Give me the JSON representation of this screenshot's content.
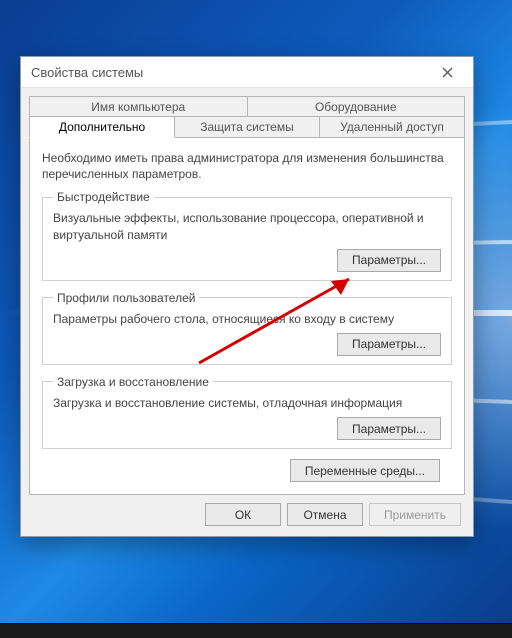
{
  "window": {
    "title": "Свойства системы"
  },
  "tabs": {
    "row1": [
      "Имя компьютера",
      "Оборудование"
    ],
    "row2": [
      "Дополнительно",
      "Защита системы",
      "Удаленный доступ"
    ],
    "active": "Дополнительно"
  },
  "intro": "Необходимо иметь права администратора для изменения большинства перечисленных параметров.",
  "groups": {
    "performance": {
      "legend": "Быстродействие",
      "desc": "Визуальные эффекты, использование процессора, оперативной и виртуальной памяти",
      "button": "Параметры..."
    },
    "profiles": {
      "legend": "Профили пользователей",
      "desc": "Параметры рабочего стола, относящиеся ко входу в систему",
      "button": "Параметры..."
    },
    "startup": {
      "legend": "Загрузка и восстановление",
      "desc": "Загрузка и восстановление системы, отладочная информация",
      "button": "Параметры..."
    }
  },
  "env_button": "Переменные среды...",
  "dialog_buttons": {
    "ok": "ОК",
    "cancel": "Отмена",
    "apply": "Применить"
  }
}
